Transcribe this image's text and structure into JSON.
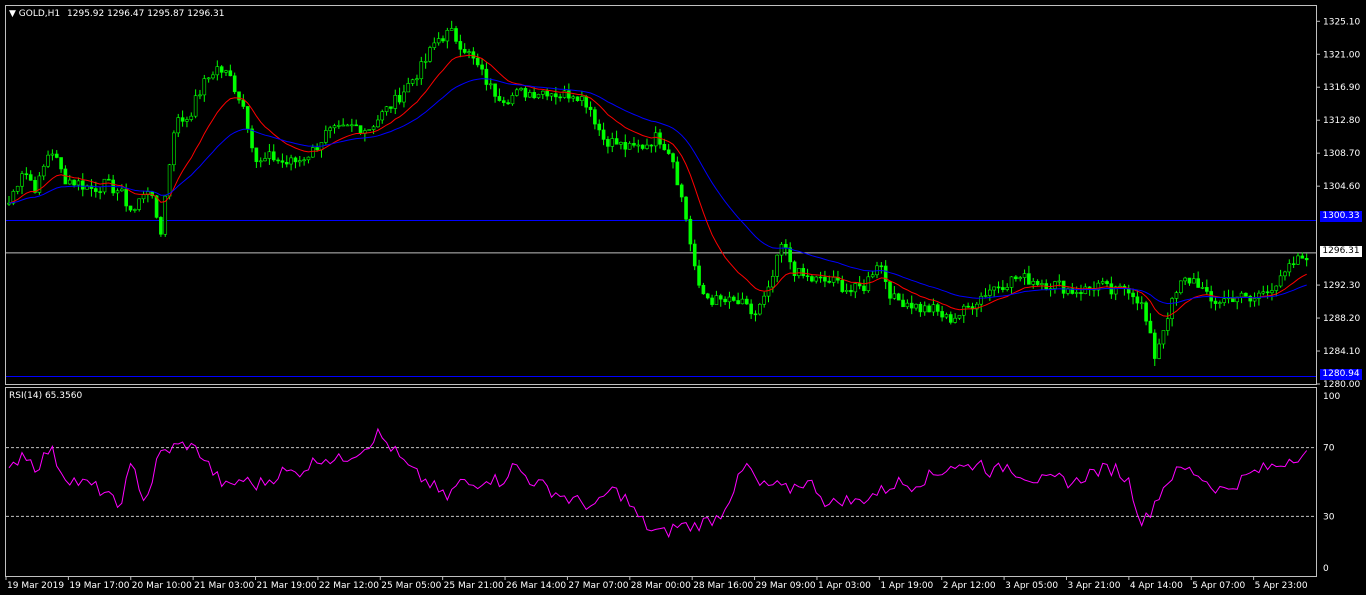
{
  "header": {
    "symbol_label": "GOLD,H1",
    "ohlc": "1295.92 1296.47 1295.87 1296.31"
  },
  "price_axis": {
    "ticks": [
      "1325.10",
      "1321.00",
      "1316.90",
      "1312.80",
      "1308.70",
      "1304.60",
      "1292.30",
      "1288.20",
      "1284.10",
      "1280.00"
    ],
    "current_price": "1296.31",
    "upper_level": "1300.33",
    "lower_level": "1280.94"
  },
  "rsi": {
    "label": "RSI(14) 65.3560",
    "ticks": [
      "100",
      "70",
      "30",
      "0"
    ]
  },
  "time_axis": {
    "labels": [
      "19 Mar 2019",
      "19 Mar 17:00",
      "20 Mar 10:00",
      "21 Mar 03:00",
      "21 Mar 19:00",
      "22 Mar 12:00",
      "25 Mar 05:00",
      "25 Mar 21:00",
      "26 Mar 14:00",
      "27 Mar 07:00",
      "28 Mar 00:00",
      "28 Mar 16:00",
      "29 Mar 09:00",
      "1 Apr 03:00",
      "1 Apr 19:00",
      "2 Apr 12:00",
      "3 Apr 05:00",
      "3 Apr 21:00",
      "4 Apr 14:00",
      "5 Apr 07:00",
      "5 Apr 23:00"
    ]
  },
  "colors": {
    "background": "#000000",
    "candle": "#00ff00",
    "ma_fast": "#ff0000",
    "ma_slow": "#0000ff",
    "level_line": "#0000ff",
    "bid_line": "#c0c0c0",
    "rsi_line": "#ff00ff",
    "grid_text": "#ffffff"
  },
  "chart_data": [
    {
      "type": "candlestick",
      "title": "GOLD,H1",
      "x_start": "19 Mar 2019",
      "x_end": "5 Apr 23:00",
      "ylim": [
        1280.0,
        1327.0
      ],
      "close_path": [
        1302.5,
        1306.8,
        1304.2,
        1309.5,
        1305.6,
        1305.0,
        1304.3,
        1304.8,
        1304.0,
        1301.2,
        1304.8,
        1299.0,
        1312.5,
        1313.2,
        1317.0,
        1319.4,
        1318.2,
        1314.5,
        1307.2,
        1308.3,
        1307.4,
        1307.8,
        1309.0,
        1311.2,
        1311.5,
        1312.1,
        1311.7,
        1313.5,
        1315.2,
        1317.4,
        1319.6,
        1322.9,
        1323.7,
        1321.8,
        1319.3,
        1316.5,
        1315.5,
        1316.2,
        1316.3,
        1316.5,
        1315.9,
        1316.3,
        1314.8,
        1310.6,
        1309.9,
        1309.2,
        1309.7,
        1310.8,
        1308.7,
        1301.0,
        1291.5,
        1290.4,
        1290.2,
        1290.0,
        1288.5,
        1291.3,
        1297.4,
        1293.8,
        1293.0,
        1292.8,
        1292.6,
        1291.5,
        1292.2,
        1295.6,
        1290.5,
        1290.3,
        1289.4,
        1289.2,
        1288.0,
        1288.8,
        1290.3,
        1291.8,
        1292.5,
        1293.2,
        1293.0,
        1292.6,
        1292.3,
        1291.6,
        1291.7,
        1292.4,
        1291.2,
        1292.2,
        1290.1,
        1283.5,
        1289.0,
        1292.8,
        1293.0,
        1290.1,
        1290.5,
        1291.0,
        1290.2,
        1291.9,
        1292.5,
        1294.9,
        1296.1
      ],
      "ma_fast": {
        "color": "#ff0000"
      },
      "ma_slow": {
        "color": "#0000ff"
      },
      "levels": [
        1300.33,
        1296.31,
        1280.94
      ]
    },
    {
      "type": "line",
      "title": "RSI(14) 65.3560",
      "ylim": [
        0,
        100
      ],
      "levels": [
        70,
        30
      ],
      "series": [
        {
          "name": "RSI(14)",
          "values": [
            55,
            68,
            58,
            70,
            54,
            50,
            48,
            44,
            35,
            60,
            38,
            66,
            70,
            72,
            67,
            55,
            46,
            52,
            48,
            51,
            56,
            55,
            60,
            65,
            62,
            66,
            70,
            78,
            70,
            60,
            53,
            48,
            40,
            50,
            48,
            53,
            50,
            60,
            52,
            48,
            44,
            40,
            38,
            35,
            46,
            42,
            30,
            22,
            20,
            25,
            24,
            27,
            30,
            45,
            60,
            47,
            48,
            45,
            50,
            48,
            36,
            40,
            38,
            42,
            45,
            50,
            48,
            52,
            55,
            60,
            58,
            62,
            55,
            60,
            55,
            52,
            50,
            52,
            49,
            55,
            57,
            58,
            50,
            25,
            40,
            53,
            58,
            55,
            48,
            45,
            50,
            55,
            58,
            60,
            65,
            66
          ]
        }
      ]
    }
  ]
}
